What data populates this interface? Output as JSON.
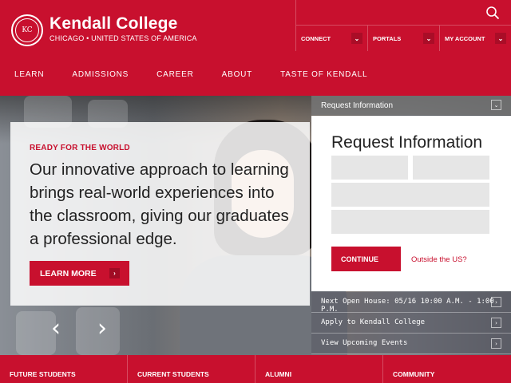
{
  "brand": {
    "name": "Kendall College",
    "tagline": "CHICAGO • UNITED STATES OF AMERICA",
    "logo_text": "KC"
  },
  "utility": {
    "links": [
      {
        "label": "CONNECT"
      },
      {
        "label": "PORTALS"
      },
      {
        "label": "MY ACCOUNT"
      }
    ]
  },
  "nav": {
    "items": [
      "LEARN",
      "ADMISSIONS",
      "CAREER",
      "ABOUT",
      "TASTE OF KENDALL"
    ]
  },
  "hero": {
    "kicker": "READY FOR THE WORLD",
    "headline": "Our innovative approach to learning brings real-world experiences into the classroom, giving our graduates a professional edge.",
    "cta_label": "LEARN MORE",
    "prev_glyph": "‹",
    "next_glyph": "›"
  },
  "request": {
    "tab_label": "Request Information",
    "title": "Request Information",
    "continue_label": "CONTINUE",
    "outside_label": "Outside the US?"
  },
  "quick_links": [
    "Next Open House: 05/16 10:00 A.M. - 1:00 P.M.",
    "Apply to Kendall College",
    "View Upcoming Events"
  ],
  "audience": [
    "FUTURE STUDENTS",
    "CURRENT STUDENTS",
    "ALUMNI",
    "COMMUNITY"
  ],
  "colors": {
    "brand_red": "#c8102e",
    "form_field": "#e6e6e6"
  }
}
